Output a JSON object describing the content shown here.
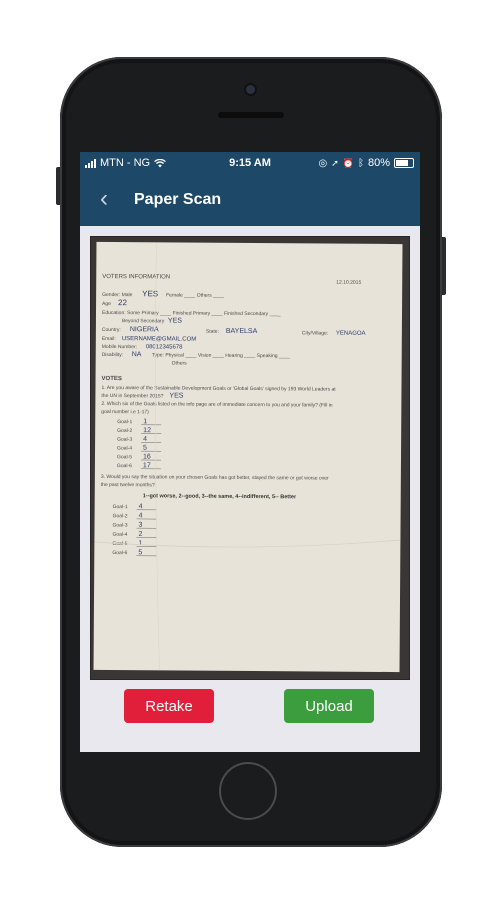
{
  "status_bar": {
    "carrier": "MTN - NG",
    "time": "9:15 AM",
    "battery_pct": "80%",
    "wifi_icon": "wifi-icon"
  },
  "nav": {
    "back_icon": "chevron-left-icon",
    "title": "Paper Scan"
  },
  "form": {
    "heading": "VOTERS INFORMATION",
    "date": "12.10.2015",
    "gender_line": "Gender: Male",
    "gender_value": "YES",
    "gender_rest": "Female ____ Others ____",
    "age_label": "Age",
    "age_value": "22",
    "education_line": "Education: Some Primary ____ Finished Primary ____ Finished Secondary ____",
    "beyond_secondary": "Beyond Secondary",
    "beyond_value": "YES",
    "country_label": "Country:",
    "country_value": "NIGERIA",
    "state_label": "State:",
    "state_value": "BAYELSA",
    "city_label": "City/Village:",
    "city_value": "YENAGOA",
    "email_label": "Email:",
    "email_value": "USERNAME@GMAIL.COM",
    "mobile_label": "Mobile Number:",
    "mobile_value": "08012345678",
    "disability_label": "Disability:",
    "disability_value": "NA",
    "disability_rest": "Type: Physical ____ Vision ____ Hearing ____ Speaking ____",
    "others_label": "Others",
    "votes_heading": "VOTES",
    "q1": "1. Are you aware of the Sustainable Development Goals or 'Global Goals' signed by 193 World Leaders at",
    "q1b": "the UN in September 2015?",
    "q1_answer": "YES",
    "q2": "2. Which six of the Goals listed on the info page are of immediate concern to you and your family? (Fill in",
    "q2b": "goal number i.e 1-17)",
    "goals_a": [
      {
        "label": "Goal-1",
        "value": "1"
      },
      {
        "label": "Goal-2",
        "value": "12"
      },
      {
        "label": "Goal-3",
        "value": "4"
      },
      {
        "label": "Goal-4",
        "value": "5"
      },
      {
        "label": "Goal-5",
        "value": "16"
      },
      {
        "label": "Goal-6",
        "value": "17"
      }
    ],
    "q3": "3. Would you say the situation on your chosen Goals has got better, stayed the same or got worse over",
    "q3b": "the past twelve months?",
    "scale": "1--got worse, 2--good, 3--the same, 4--indifferent, 5-- Better",
    "goals_b": [
      {
        "label": "Goal-1",
        "value": "4"
      },
      {
        "label": "Goal-2",
        "value": "4"
      },
      {
        "label": "Goal-3",
        "value": "3"
      },
      {
        "label": "Goal-4",
        "value": "2"
      },
      {
        "label": "Goal-5",
        "value": "1"
      },
      {
        "label": "Goal-6",
        "value": "5"
      }
    ]
  },
  "actions": {
    "retake_label": "Retake",
    "upload_label": "Upload"
  },
  "colors": {
    "nav_bg": "#1d4868",
    "retake": "#e21f3b",
    "upload": "#3c9d3f",
    "screen_bg": "#e9e8ee"
  }
}
